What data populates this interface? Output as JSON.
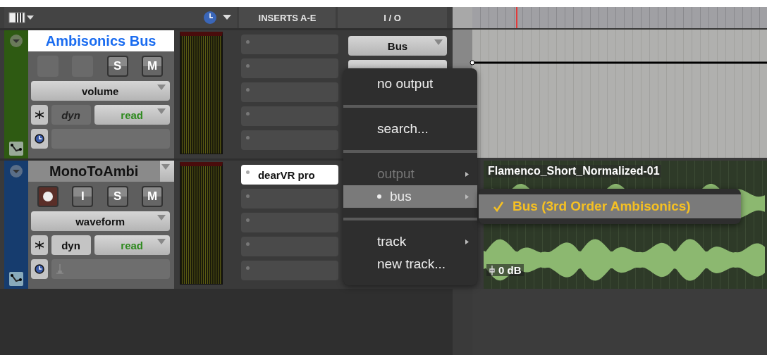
{
  "header": {
    "inserts": "INSERTS A-E",
    "io": "I / O"
  },
  "tracks": [
    {
      "kind": "aux",
      "name": "Ambisonics Bus",
      "selected": true,
      "color": "#2e5a12",
      "buttons": [
        {
          "kind": "blank"
        },
        {
          "kind": "blank"
        },
        {
          "kind": "toggle",
          "label": "S"
        },
        {
          "kind": "toggle",
          "label": "M"
        }
      ],
      "view": "volume",
      "dyn": "dyn",
      "dyn_enabled": false,
      "automation": "read",
      "inserts": [
        {
          "kind": "empty"
        },
        {
          "kind": "empty"
        },
        {
          "kind": "empty"
        },
        {
          "kind": "empty"
        },
        {
          "kind": "empty"
        }
      ],
      "output": "Bus",
      "lane": {
        "kind": "automation"
      }
    },
    {
      "kind": "audio",
      "name": "MonoToAmbi",
      "selected": false,
      "color": "#163c6e",
      "buttons": [
        {
          "kind": "record"
        },
        {
          "kind": "toggle",
          "label": "I"
        },
        {
          "kind": "toggle",
          "label": "S"
        },
        {
          "kind": "toggle",
          "label": "M"
        }
      ],
      "view": "waveform",
      "dyn": "dyn",
      "dyn_enabled": true,
      "automation": "read",
      "inserts": [
        {
          "kind": "plugin",
          "name": "dearVR pro"
        },
        {
          "kind": "empty"
        },
        {
          "kind": "empty"
        },
        {
          "kind": "empty"
        },
        {
          "kind": "empty"
        }
      ],
      "lane": {
        "kind": "clip",
        "clip_name": "Flamenco_Short_Normalized-01",
        "gain": "0 dB"
      }
    }
  ],
  "menu": {
    "items": [
      {
        "kind": "item",
        "label": "no output",
        "disabled": false,
        "selected": false,
        "submenu": false
      },
      {
        "kind": "separator"
      },
      {
        "kind": "item",
        "label": "search...",
        "disabled": false,
        "selected": false,
        "submenu": false
      },
      {
        "kind": "separator"
      },
      {
        "kind": "item",
        "label": "output",
        "disabled": true,
        "selected": false,
        "submenu": true
      },
      {
        "kind": "item",
        "label": "bus",
        "disabled": false,
        "selected": true,
        "submenu": true
      },
      {
        "kind": "separator"
      },
      {
        "kind": "item",
        "label": "track",
        "disabled": false,
        "selected": false,
        "submenu": true
      },
      {
        "kind": "item",
        "label": "new track...",
        "disabled": false,
        "selected": false,
        "submenu": false
      }
    ],
    "submenu": [
      {
        "label": "Bus (3rd Order Ambisonics)",
        "checked": true,
        "selected": true
      }
    ]
  }
}
